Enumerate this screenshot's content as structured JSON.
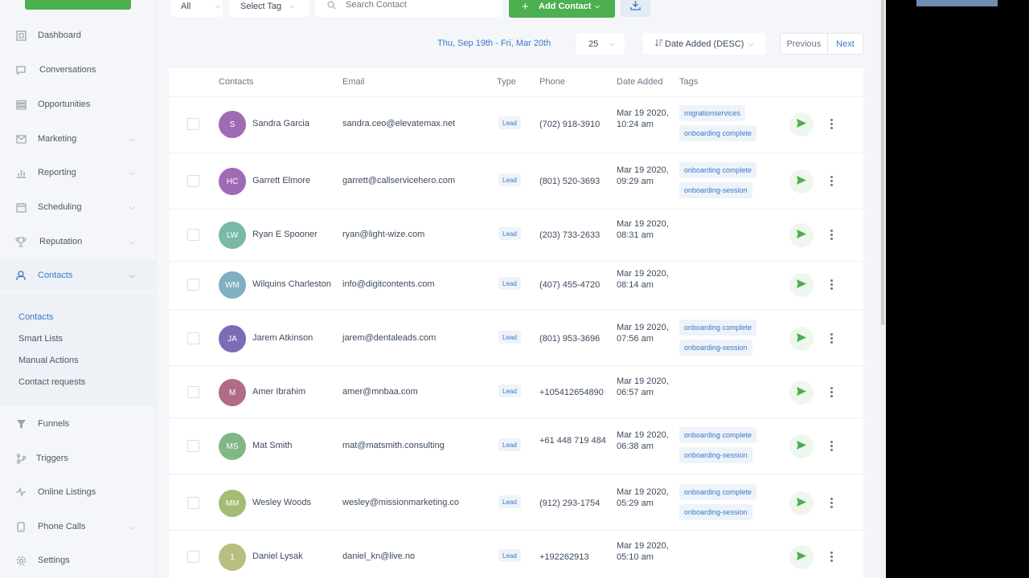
{
  "sidebar": {
    "items": [
      {
        "label": "Dashboard",
        "icon": "dashboard-icon"
      },
      {
        "label": "Conversations",
        "icon": "chat-icon"
      },
      {
        "label": "Opportunities",
        "icon": "layers-icon"
      },
      {
        "label": "Marketing",
        "icon": "mail-icon"
      },
      {
        "label": "Reporting",
        "icon": "chart-icon"
      },
      {
        "label": "Scheduling",
        "icon": "calendar-icon"
      },
      {
        "label": "Reputation",
        "icon": "trophy-icon"
      },
      {
        "label": "Contacts",
        "icon": "user-icon"
      },
      {
        "label": "Funnels",
        "icon": "funnel-icon"
      },
      {
        "label": "Triggers",
        "icon": "trigger-icon"
      },
      {
        "label": "Online Listings",
        "icon": "pulse-icon"
      },
      {
        "label": "Phone Calls",
        "icon": "phone-icon"
      },
      {
        "label": "Settings",
        "icon": "gear-icon"
      }
    ],
    "contacts_sub": [
      "Contacts",
      "Smart Lists",
      "Manual Actions",
      "Contact requests"
    ]
  },
  "toolbar": {
    "filter_value": "All",
    "tag_select": "Select Tag",
    "search_placeholder": "Search Contact",
    "add_contact_label": "Add Contact",
    "date_range": "Thu, Sep 19th - Fri, Mar 20th",
    "page_size": "25",
    "sort_label": "Date Added (DESC)",
    "prev_label": "Previous",
    "next_label": "Next"
  },
  "table": {
    "headers": [
      "Contacts",
      "Email",
      "Type",
      "Phone",
      "Date Added",
      "Tags"
    ],
    "rows": [
      {
        "initials": "S",
        "color": "#a06bb5",
        "name": "Sandra Garcia",
        "email": "sandra.ceo@elevatemax.net",
        "type": "Lead",
        "phone": "(702) 918-3910",
        "date": "Mar 19 2020, 10:24 am",
        "tags": [
          "migrationservices",
          "onboarding complete"
        ]
      },
      {
        "initials": "HC",
        "color": "#a06bb5",
        "name": "Garrett Elmore",
        "email": "garrett@callservicehero.com",
        "type": "Lead",
        "phone": "(801) 520-3693",
        "date": "Mar 19 2020, 09:29 am",
        "tags": [
          "onboarding complete",
          "onboarding-session"
        ]
      },
      {
        "initials": "LW",
        "color": "#7ab8a8",
        "name": "Ryan E Spooner",
        "email": "ryan@light-wize.com",
        "type": "Lead",
        "phone": "(203) 733-2633",
        "date": "Mar 19 2020, 08:31 am",
        "tags": []
      },
      {
        "initials": "WM",
        "color": "#7fb0c0",
        "name": "Wilquins Charleston",
        "email": "info@digitcontents.com",
        "type": "Lead",
        "phone": "(407) 455-4720",
        "date": "Mar 19 2020, 08:14 am",
        "tags": []
      },
      {
        "initials": "JA",
        "color": "#7c6bb5",
        "name": "Jarem Atkinson",
        "email": "jarem@dentaleads.com",
        "type": "Lead",
        "phone": "(801) 953-3696",
        "date": "Mar 19 2020, 07:56 am",
        "tags": [
          "onboarding complete",
          "onboarding-session"
        ]
      },
      {
        "initials": "M",
        "color": "#b06b88",
        "name": "Amer Ibrahim",
        "email": "amer@mnbaa.com",
        "type": "Lead",
        "phone": "+105412654890",
        "date": "Mar 19 2020, 06:57 am",
        "tags": []
      },
      {
        "initials": "MS",
        "color": "#7fb885",
        "name": "Mat Smith",
        "email": "mat@matsmith.consulting",
        "type": "Lead",
        "phone": "+61 448 719 484",
        "date": "Mar 19 2020, 06:38 am",
        "tags": [
          "onboarding complete",
          "onboarding-session"
        ]
      },
      {
        "initials": "MM",
        "color": "#a4bb74",
        "name": "Wesley Woods",
        "email": "wesley@missionmarketing.co",
        "type": "Lead",
        "phone": "(912) 293-1754",
        "date": "Mar 19 2020, 05:29 am",
        "tags": [
          "onboarding complete",
          "onboarding-session"
        ]
      },
      {
        "initials": "1",
        "color": "#b9bd80",
        "name": "Daniel Lysak",
        "email": "daniel_kn@live.no",
        "type": "Lead",
        "phone": "+192262913",
        "date": "Mar 19 2020, 05:10 am",
        "tags": []
      }
    ]
  }
}
